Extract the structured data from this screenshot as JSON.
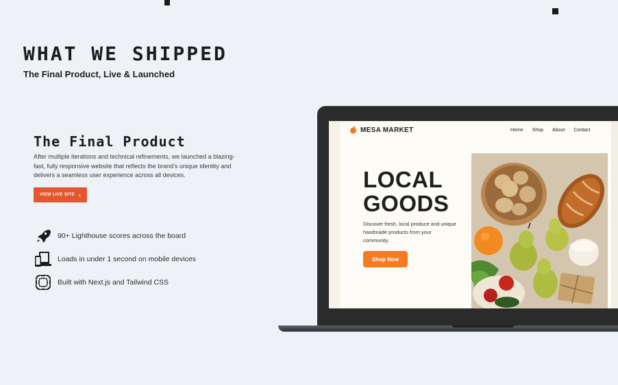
{
  "section": {
    "title": "WHAT WE SHIPPED",
    "subtitle": "The Final Product, Live & Launched"
  },
  "product": {
    "title": "The Final Product",
    "description": "After multiple iterations and technical refinements, we launched a blazing-fast, fully responsive website that reflects the brand's unique identity and delivers a seamless user experience across all devices.",
    "cta_label": "VIEW LIVE SITE"
  },
  "features": [
    {
      "icon": "rocket-icon",
      "text": "90+ Lighthouse scores across the board"
    },
    {
      "icon": "devices-icon",
      "text": "Loads in under 1 second on mobile devices"
    },
    {
      "icon": "frame-icon",
      "text": "Built with Next.js and Tailwind CSS"
    }
  ],
  "mockup": {
    "brand": "MESA MARKET",
    "nav": [
      "Home",
      "Shop",
      "About",
      "Contact"
    ],
    "hero_line1": "LOCAL",
    "hero_line2": "GOODS",
    "hero_desc": "Discover fresh, local produce and unique hasdmade products from your community.",
    "hero_cta": "Shop Now",
    "accent": "#f47b20"
  },
  "colors": {
    "background": "#eef2f6",
    "cta": "#e4572e",
    "text": "#1b1b1b"
  }
}
